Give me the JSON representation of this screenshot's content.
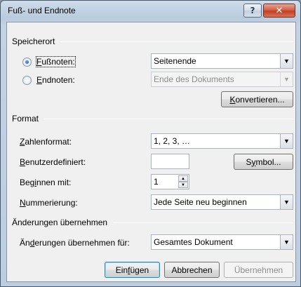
{
  "window": {
    "title": "Fuß- und Endnote",
    "help_glyph": "?",
    "close_glyph": "✕"
  },
  "speicherort": {
    "heading": "Speicherort",
    "fussnoten": {
      "label_pre": "",
      "label_u": "F",
      "label_post": "ußnoten:",
      "selected": true,
      "value": "Seitenende"
    },
    "endnoten": {
      "label_pre": "",
      "label_u": "E",
      "label_post": "ndnoten:",
      "selected": false,
      "value": "Ende des Dokuments"
    },
    "konvertieren": {
      "pre": "",
      "u": "K",
      "post": "onvertieren..."
    }
  },
  "format": {
    "heading": "Format",
    "zahlenformat": {
      "label_u": "Z",
      "label_post": "ahlenformat:",
      "value": "1, 2, 3, …"
    },
    "benutzerdefiniert": {
      "label_u": "B",
      "label_post": "enutzerdefiniert:",
      "value": ""
    },
    "symbol": {
      "pre": "S",
      "u": "y",
      "post": "mbol..."
    },
    "beginnen": {
      "label_pre": "Beg",
      "label_u": "i",
      "label_post": "nnen mit:",
      "value": "1"
    },
    "nummerierung": {
      "label_u": "N",
      "label_post": "ummerierung:",
      "value": "Jede Seite neu beginnen"
    }
  },
  "aenderungen": {
    "heading": "Änderungen übernehmen",
    "label_pre": "Än",
    "label_u": "d",
    "label_post": "erungen übernehmen für:",
    "value": "Gesamtes Dokument"
  },
  "buttons": {
    "einfuegen": {
      "pre": "Ein",
      "u": "f",
      "post": "ügen"
    },
    "abbrechen": "Abbrechen",
    "uebernehmen": "Übernehmen"
  },
  "icons": {
    "dropdown": "▼",
    "spin_up": "▲",
    "spin_down": "▼"
  }
}
